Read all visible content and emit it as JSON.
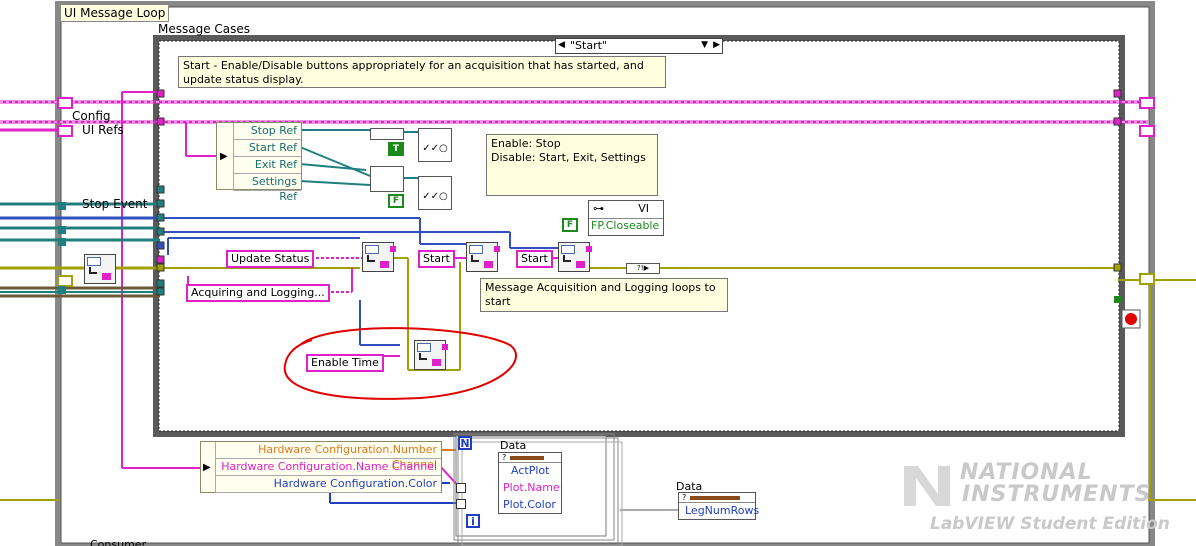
{
  "loop_label": "UI Message Loop",
  "case_structure": {
    "label": "Message Cases",
    "selector_value": "\"Start\""
  },
  "comments": {
    "case_description": "Start - Enable/Disable buttons appropriately for an acquisition that has started, and update status display.",
    "enable_disable": "Enable: Stop\nDisable: Start, Exit, Settings",
    "message_loops": "Message Acquisition and Logging loops to start"
  },
  "wire_labels": {
    "config": "Config",
    "ui_refs": "UI Refs",
    "stop_event": "Stop Event",
    "bottom_partial": "Consumer..."
  },
  "unbundle_refs": [
    "Stop Ref",
    "Start Ref",
    "Exit Ref",
    "Settings Ref"
  ],
  "bool_constants": {
    "true": "T",
    "false": "F",
    "closeable": "F"
  },
  "property_node": {
    "class": "VI",
    "property": "FP.Closeable"
  },
  "string_constants": {
    "update_status": "Update Status",
    "acquiring": "Acquiring and Logging...",
    "start_1": "Start",
    "start_2": "Start",
    "enable_time": "Enable Time"
  },
  "hardware_unbundle": [
    "Hardware Configuration.Number Channel",
    "Hardware Configuration.Name Channel",
    "Hardware Configuration.Color"
  ],
  "for_loop": {
    "count_label": "N",
    "index_label": "i"
  },
  "data_node_1": {
    "label": "Data",
    "class": "?",
    "props": [
      "ActPlot",
      "Plot.Name",
      "Plot.Color"
    ]
  },
  "data_node_2": {
    "label": "Data",
    "class": "?",
    "props": [
      "LegNumRows"
    ]
  },
  "watermark": {
    "line1": "NATIONAL",
    "line2": "INSTRUMENTS",
    "line3": "LabVIEW Student Edition"
  },
  "colors": {
    "string_wire": "#e020c8",
    "cluster_wire": "#a0a000",
    "ref_wire": "#1f7f7f",
    "int_wire": "#1f3fbf",
    "annotation_circle": "#e00000"
  }
}
